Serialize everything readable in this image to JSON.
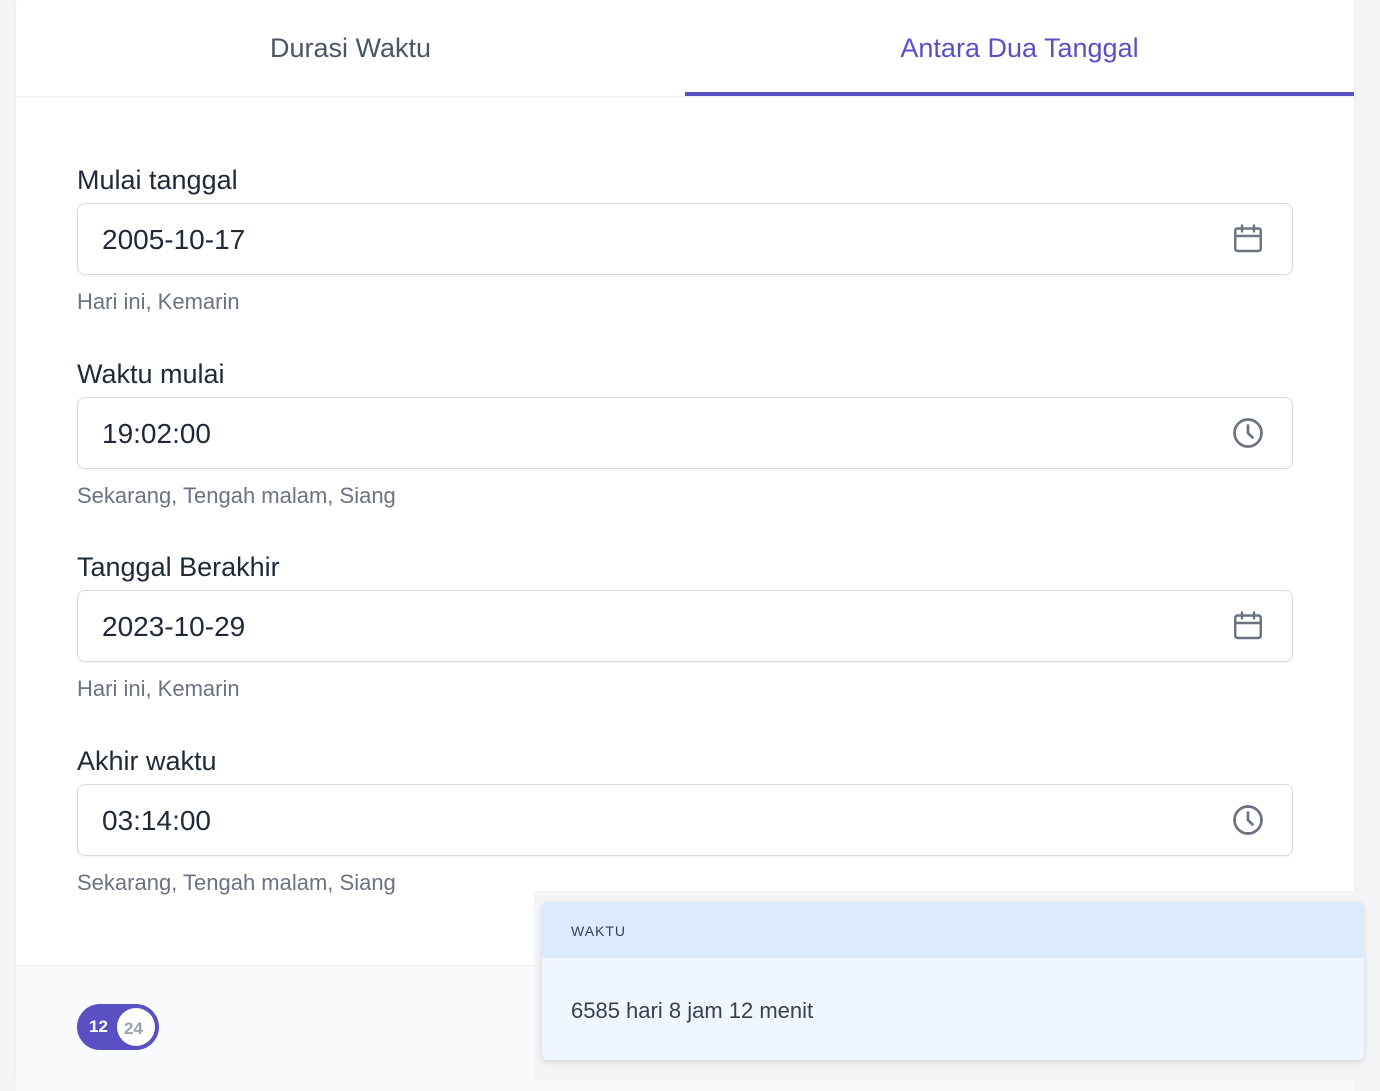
{
  "tabs": [
    {
      "label": "Durasi Waktu",
      "active": false
    },
    {
      "label": "Antara Dua Tanggal",
      "active": true
    }
  ],
  "accent_color": "#5b4fc4",
  "fields": [
    {
      "label": "Mulai tanggal",
      "value": "2005-10-17",
      "icon": "calendar-icon",
      "hint": "Hari ini, Kemarin"
    },
    {
      "label": "Waktu mulai",
      "value": "19:02:00",
      "icon": "clock-icon",
      "hint": "Sekarang, Tengah malam, Siang"
    },
    {
      "label": "Tanggal Berakhir",
      "value": "2023-10-29",
      "icon": "calendar-icon",
      "hint": "Hari ini, Kemarin"
    },
    {
      "label": "Akhir waktu",
      "value": "03:14:00",
      "icon": "clock-icon",
      "hint": "Sekarang, Tengah malam, Siang"
    }
  ],
  "toggle": {
    "left_label": "12",
    "right_label": "24",
    "state": "12"
  },
  "result": {
    "title": "WAKTU",
    "value": "6585 hari 8 jam 12 menit"
  }
}
